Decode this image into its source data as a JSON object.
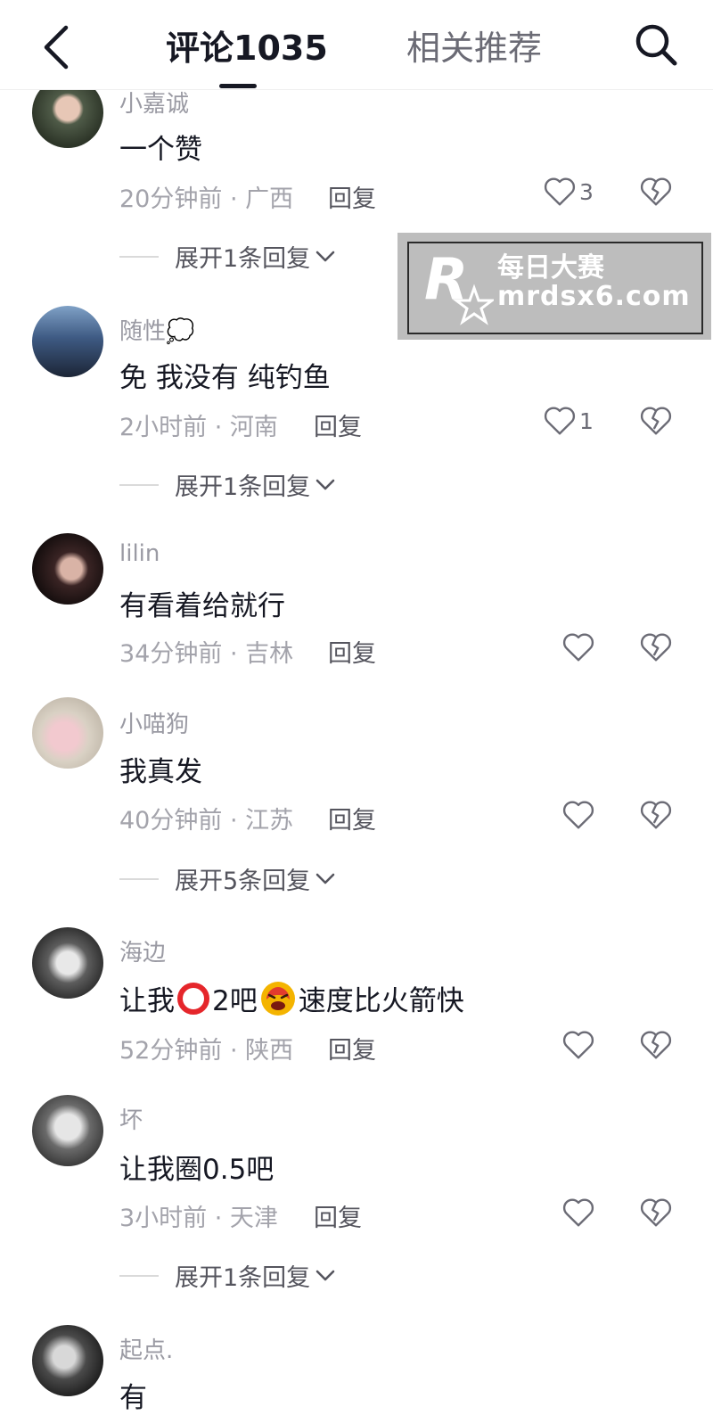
{
  "header": {
    "active_tab": "评论1035",
    "inactive_tab": "相关推荐"
  },
  "watermark": {
    "title": "每日大赛",
    "url": "mrdsx6.com"
  },
  "comments": [
    {
      "username": "小嘉诚",
      "text": "一个赞",
      "time_region": "20分钟前 · 广西",
      "reply": "回复",
      "likes": "3",
      "expand": "展开1条回复"
    },
    {
      "username": "随性💭",
      "text": "免 我没有 纯钓鱼",
      "time_region": "2小时前 · 河南",
      "reply": "回复",
      "likes": "1",
      "expand": "展开1条回复"
    },
    {
      "username": "lilin",
      "text": "有看着给就行",
      "time_region": "34分钟前 · 吉林",
      "reply": "回复",
      "likes": "",
      "expand": ""
    },
    {
      "username": "小喵狗",
      "text": "我真发",
      "time_region": "40分钟前 · 江苏",
      "reply": "回复",
      "likes": "",
      "expand": "展开5条回复"
    },
    {
      "username": "海边",
      "text_parts": [
        "让我",
        "2吧",
        "速度比火箭快"
      ],
      "time_region": "52分钟前 · 陕西",
      "reply": "回复",
      "likes": "",
      "expand": ""
    },
    {
      "username": "坏",
      "text": "让我圈0.5吧",
      "time_region": "3小时前 · 天津",
      "reply": "回复",
      "likes": "",
      "expand": "展开1条回复"
    },
    {
      "username": "起点.",
      "text": "有",
      "time_region": "",
      "reply": "",
      "likes": "",
      "expand": ""
    }
  ]
}
